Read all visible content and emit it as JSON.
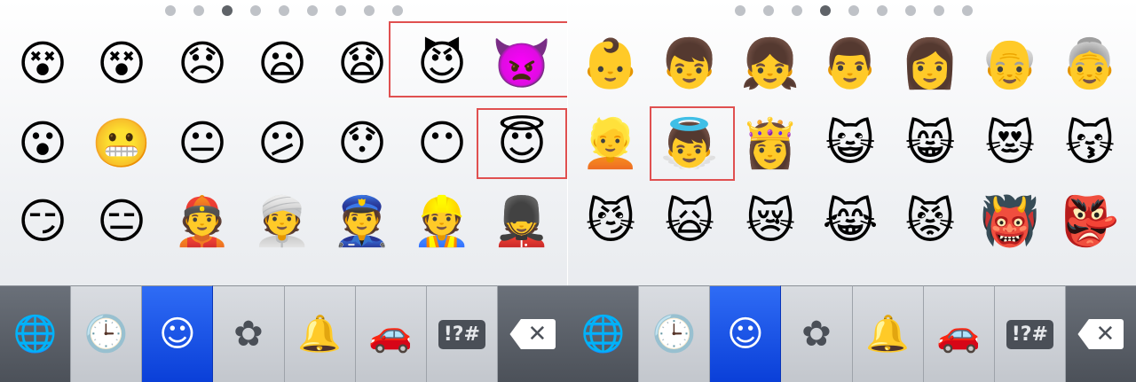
{
  "left_panel": {
    "page_dots": {
      "count": 9,
      "active_index": 2
    },
    "rows": [
      [
        {
          "name": "dizzy-face-emoji",
          "glyph": "😵"
        },
        {
          "name": "astonished-dizzy-face-emoji",
          "glyph": "😵"
        },
        {
          "name": "confounded-face-emoji",
          "glyph": "😞"
        },
        {
          "name": "frowning-face-emoji",
          "glyph": "😦"
        },
        {
          "name": "anguished-face-emoji",
          "glyph": "😧"
        },
        {
          "name": "smiling-imp-emoji",
          "glyph": "😈"
        },
        {
          "name": "angry-imp-emoji",
          "glyph": "👿"
        }
      ],
      [
        {
          "name": "open-mouth-face-emoji",
          "glyph": "😮"
        },
        {
          "name": "grimacing-face-emoji",
          "glyph": "😬"
        },
        {
          "name": "neutral-face-emoji",
          "glyph": "😐"
        },
        {
          "name": "confused-face-emoji",
          "glyph": "😕"
        },
        {
          "name": "hushed-face-emoji",
          "glyph": "😯"
        },
        {
          "name": "no-mouth-face-emoji",
          "glyph": "😶"
        },
        {
          "name": "innocent-face-emoji",
          "glyph": "😇"
        }
      ],
      [
        {
          "name": "smirking-face-emoji",
          "glyph": "😏"
        },
        {
          "name": "expressionless-face-emoji",
          "glyph": "😑"
        },
        {
          "name": "man-with-gua-pi-mao-emoji",
          "glyph": "👲"
        },
        {
          "name": "man-with-turban-emoji",
          "glyph": "👳"
        },
        {
          "name": "police-officer-emoji",
          "glyph": "👮"
        },
        {
          "name": "construction-worker-emoji",
          "glyph": "👷"
        },
        {
          "name": "guardsman-emoji",
          "glyph": "💂"
        }
      ]
    ]
  },
  "right_panel": {
    "page_dots": {
      "count": 9,
      "active_index": 3
    },
    "rows": [
      [
        {
          "name": "baby-emoji",
          "glyph": "👶"
        },
        {
          "name": "boy-emoji",
          "glyph": "👦"
        },
        {
          "name": "girl-emoji",
          "glyph": "👧"
        },
        {
          "name": "man-emoji",
          "glyph": "👨"
        },
        {
          "name": "woman-emoji",
          "glyph": "👩"
        },
        {
          "name": "older-man-emoji",
          "glyph": "👴"
        },
        {
          "name": "older-woman-emoji",
          "glyph": "👵"
        }
      ],
      [
        {
          "name": "person-blond-hair-emoji",
          "glyph": "👱"
        },
        {
          "name": "baby-angel-emoji",
          "glyph": "👼"
        },
        {
          "name": "princess-emoji",
          "glyph": "👸"
        },
        {
          "name": "smiley-cat-emoji",
          "glyph": "😺"
        },
        {
          "name": "grinning-cat-emoji",
          "glyph": "😸"
        },
        {
          "name": "heart-eyes-cat-emoji",
          "glyph": "😻"
        },
        {
          "name": "kissing-cat-emoji",
          "glyph": "😽"
        }
      ],
      [
        {
          "name": "smirk-cat-emoji",
          "glyph": "😼"
        },
        {
          "name": "scream-cat-emoji",
          "glyph": "🙀"
        },
        {
          "name": "crying-cat-emoji",
          "glyph": "😿"
        },
        {
          "name": "joy-cat-emoji",
          "glyph": "😹"
        },
        {
          "name": "pouting-cat-emoji",
          "glyph": "😾"
        },
        {
          "name": "japanese-ogre-emoji",
          "glyph": "👹"
        },
        {
          "name": "japanese-goblin-emoji",
          "glyph": "👺"
        }
      ]
    ]
  },
  "toolbar": {
    "keys": [
      {
        "name": "globe-key",
        "icon": "globe-icon",
        "glyph": "🌐",
        "style": "dark"
      },
      {
        "name": "recents-key",
        "icon": "clock-icon",
        "glyph": "🕒",
        "style": "normal"
      },
      {
        "name": "people-category-key",
        "icon": "smiley-icon",
        "glyph": "☺",
        "style": "active"
      },
      {
        "name": "nature-category-key",
        "icon": "flower-icon",
        "glyph": "✿",
        "style": "normal"
      },
      {
        "name": "objects-category-key",
        "icon": "bell-icon",
        "glyph": "🔔",
        "style": "normal"
      },
      {
        "name": "places-category-key",
        "icon": "car-icon",
        "glyph": "🚗",
        "style": "normal"
      },
      {
        "name": "symbols-category-key",
        "icon": "symbols-icon",
        "label": "!?#",
        "style": "normal"
      },
      {
        "name": "backspace-key",
        "icon": "backspace-icon",
        "glyph": "✕",
        "style": "dark"
      }
    ]
  },
  "colors": {
    "active_key": "#0a3fd8",
    "highlight_border": "#e05050",
    "dark_key": "#4c5159"
  }
}
